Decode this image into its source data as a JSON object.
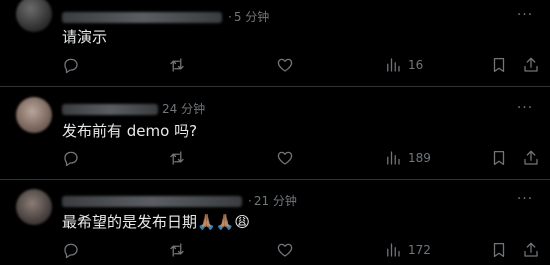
{
  "posts": [
    {
      "handle_suffix": "",
      "separator": "·",
      "time": "5 分钟",
      "text": "请演示",
      "views": "16",
      "more_label": "···"
    },
    {
      "handle_suffix": "",
      "separator": "",
      "time": "24 分钟",
      "text": "发布前有 demo 吗?",
      "views": "189",
      "more_label": "···"
    },
    {
      "handle_suffix": "",
      "separator": "·",
      "time": "21 分钟",
      "text": "最希望的是发布日期🙏🏽🙏🏽😩",
      "views": "172",
      "more_label": "···"
    }
  ],
  "icons": [
    "reply-icon",
    "repost-icon",
    "like-icon",
    "views-icon",
    "bookmark-icon",
    "share-icon",
    "more-icon"
  ],
  "colors": {
    "background": "#000000",
    "text": "#e7e9ea",
    "secondary": "#71767b",
    "divider": "#2f3336"
  }
}
